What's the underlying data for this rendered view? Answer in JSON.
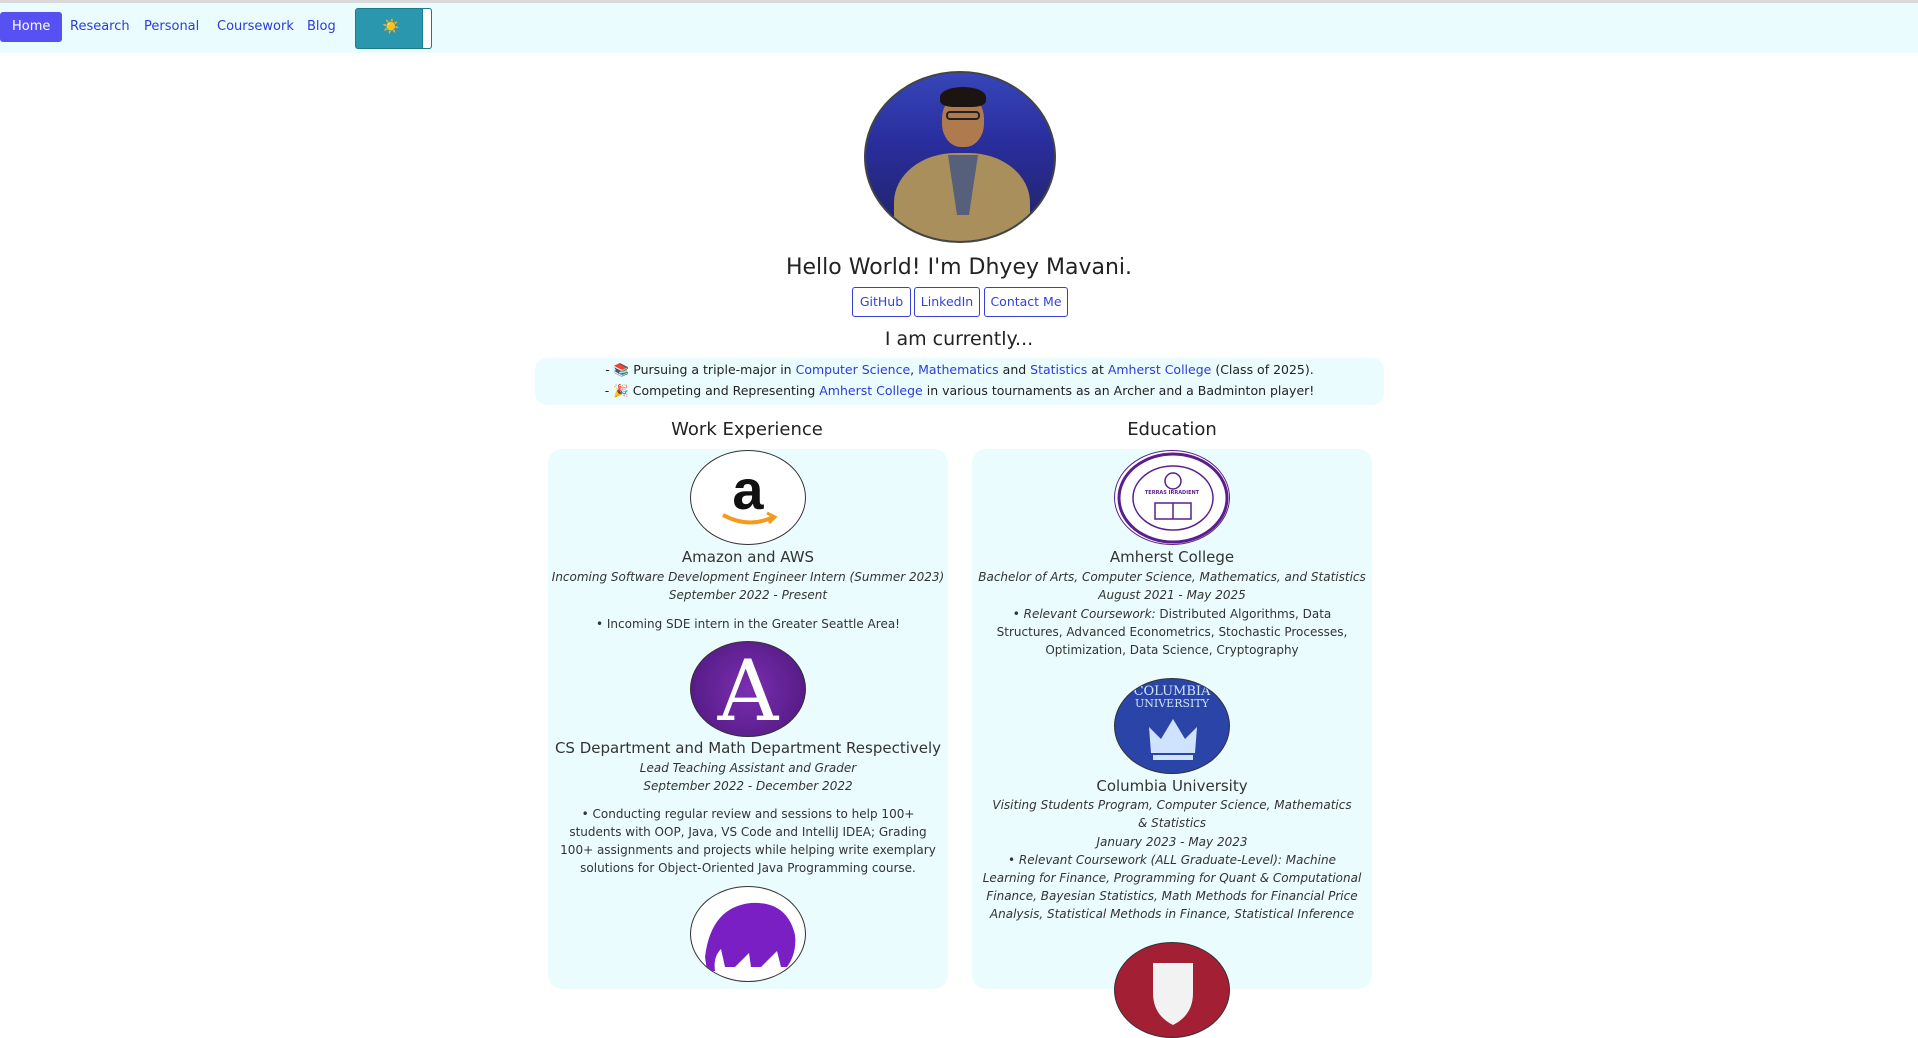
{
  "nav": {
    "items": [
      "Home",
      "Research",
      "Personal",
      "Coursework",
      "Blog"
    ],
    "theme_toggle_icon": "☀️"
  },
  "profile": {
    "heading": "Hello World! I'm Dhyey Mavani.",
    "buttons": [
      "GitHub",
      "LinkedIn",
      "Contact Me"
    ]
  },
  "currently": {
    "heading": "I am currently...",
    "line1": {
      "prefix": "- 📚 Pursuing a triple-major in ",
      "cs": "Computer Science",
      "sep1": ", ",
      "math": "Mathematics",
      "sep2": " and ",
      "stats": "Statistics",
      "sep3": " at ",
      "college": "Amherst College",
      "suffix": " (Class of 2025)."
    },
    "line2": {
      "prefix": "- 🎉 Competing and Representing ",
      "college": "Amherst College",
      "suffix": " in various tournaments as an Archer and a Badminton player!"
    }
  },
  "work": {
    "title": "Work Experience",
    "entries": [
      {
        "org": "Amazon and AWS",
        "role": "Incoming Software Development Engineer Intern (Summer 2023)",
        "dates": "September 2022 - Present",
        "desc": "• Incoming SDE intern in the Greater Seattle Area!",
        "logo_text": "a"
      },
      {
        "org": "CS Department and Math Department Respectively",
        "role": "Lead Teaching Assistant and Grader",
        "dates": "September 2022 - December 2022",
        "desc": "• Conducting regular review and sessions to help 100+ students with OOP, Java, VS Code and IntelliJ IDEA; Grading 100+ assignments and projects while helping write exemplary solutions for Object-Oriented Java Programming course.",
        "logo_text": "A"
      }
    ]
  },
  "education": {
    "title": "Education",
    "entries": [
      {
        "org": "Amherst College",
        "role": "Bachelor of Arts, Computer Science, Mathematics, and Statistics",
        "dates": "August 2021 - May 2025",
        "desc_label": "• Relevant Coursework:",
        "desc": " Distributed Algorithms, Data Structures, Advanced Econometrics, Stochastic Processes, Optimization, Data Science, Cryptography",
        "seal_text": "TERRAS IRRADIENT"
      },
      {
        "org": "Columbia University",
        "role": "Visiting Students Program, Computer Science, Mathematics & Statistics",
        "dates": "January 2023 - May 2023",
        "desc": "• Relevant Coursework (ALL Graduate-Level): Machine Learning for Finance, Programming for Quant & Computational Finance, Bayesian Statistics, Math Methods for Financial Price Analysis, Statistical Methods in Finance, Statistical Inference",
        "logo_line1": "COLUMBIA",
        "logo_line2": "UNIVERSITY"
      }
    ]
  },
  "colors": {
    "accent": "#5750f2",
    "link": "#2d3bd8",
    "panel": "#eafcfe"
  }
}
